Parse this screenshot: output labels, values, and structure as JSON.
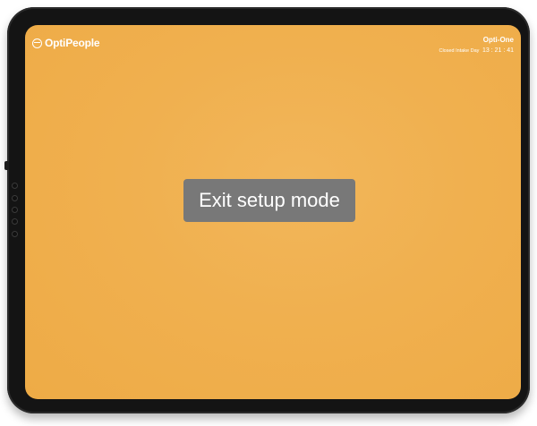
{
  "brand": {
    "name": "OptiPeople",
    "logo_icon": "optipeople-logo-icon"
  },
  "status": {
    "device_name": "Opti-One",
    "subtitle": "Closed Intake Day",
    "clock": "13 : 21 : 41"
  },
  "main": {
    "exit_button_label": "Exit setup mode"
  },
  "colors": {
    "background": "#f0b04f",
    "button": "#787878",
    "text": "#ffffff",
    "bezel": "#141414"
  }
}
